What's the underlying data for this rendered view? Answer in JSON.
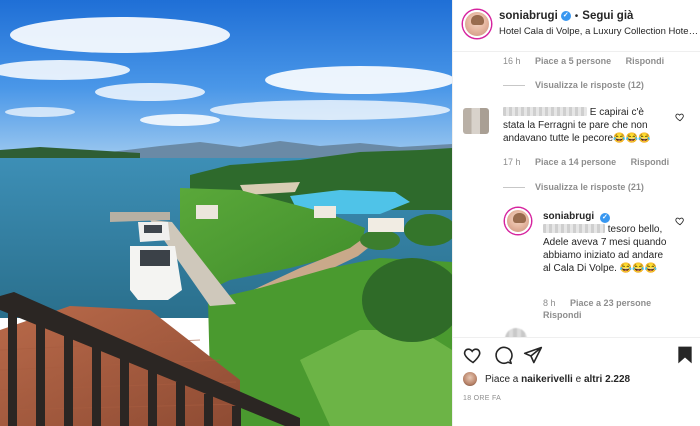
{
  "header": {
    "username": "soniabrugi",
    "verified_mark": "✓",
    "separator": "•",
    "follow_label": "Segui già",
    "location": "Hotel Cala di Volpe, a Luxury Collection Hotel, Costa Smeralda"
  },
  "thread": {
    "top_meta": {
      "time": "16 h",
      "likes": "Piace a 5 persone",
      "reply": "Rispondi"
    },
    "view_replies_1": "Visualizza le risposte (12)",
    "comment_1": {
      "text": "E capirai c'è stata la Ferragni te pare che non andavano tutte le pecore😂😂😂",
      "time": "17 h",
      "likes": "Piace a 14 persone",
      "reply": "Rispondi"
    },
    "view_replies_2": "Visualizza le risposte (21)",
    "reply_1": {
      "username": "soniabrugi",
      "text": "tesoro bello, Adele aveva 7 mesi quando abbiamo iniziato ad andare al Cala Di Volpe. 😂😂😂",
      "time": "8 h",
      "likes": "Piace a 23 persone",
      "reply": "Rispondi"
    }
  },
  "actions": {
    "like_icon": "heart-outline-icon",
    "comment_icon": "comment-bubble-icon",
    "share_icon": "paper-plane-icon",
    "save_icon": "bookmark-filled-icon"
  },
  "likes": {
    "prefix": "Piace a ",
    "user": "naikerivelli",
    "suffix": " e ",
    "others": "altri 2.228"
  },
  "posted_ago": "18 ORE FA",
  "colors": {
    "verified": "#3897f0",
    "muted": "#8e8e8e",
    "text": "#262626",
    "story_ring": "#d6249f"
  }
}
